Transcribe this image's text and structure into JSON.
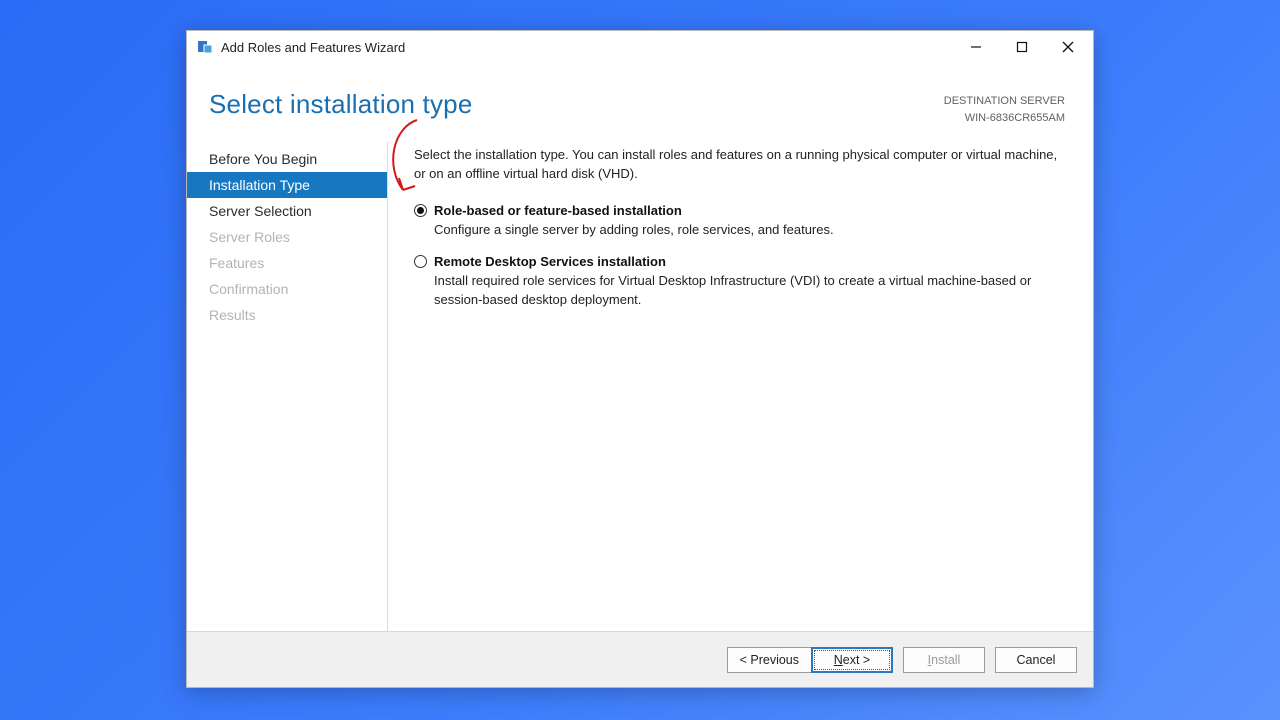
{
  "titlebar": {
    "title": "Add Roles and Features Wizard"
  },
  "header": {
    "page_title": "Select installation type",
    "dest_label": "DESTINATION SERVER",
    "dest_server": "WIN-6836CR655AM"
  },
  "sidebar": {
    "items": [
      {
        "label": "Before You Begin",
        "state": "enabled"
      },
      {
        "label": "Installation Type",
        "state": "active"
      },
      {
        "label": "Server Selection",
        "state": "enabled"
      },
      {
        "label": "Server Roles",
        "state": "disabled"
      },
      {
        "label": "Features",
        "state": "disabled"
      },
      {
        "label": "Confirmation",
        "state": "disabled"
      },
      {
        "label": "Results",
        "state": "disabled"
      }
    ]
  },
  "main": {
    "intro": "Select the installation type. You can install roles and features on a running physical computer or virtual machine, or on an offline virtual hard disk (VHD).",
    "options": [
      {
        "title": "Role-based or feature-based installation",
        "desc": "Configure a single server by adding roles, role services, and features.",
        "selected": true
      },
      {
        "title": "Remote Desktop Services installation",
        "desc": "Install required role services for Virtual Desktop Infrastructure (VDI) to create a virtual machine-based or session-based desktop deployment.",
        "selected": false
      }
    ]
  },
  "footer": {
    "previous": "< Previous",
    "next_prefix": "N",
    "next_suffix": "ext >",
    "install_prefix": "I",
    "install_suffix": "nstall",
    "cancel": "Cancel"
  }
}
